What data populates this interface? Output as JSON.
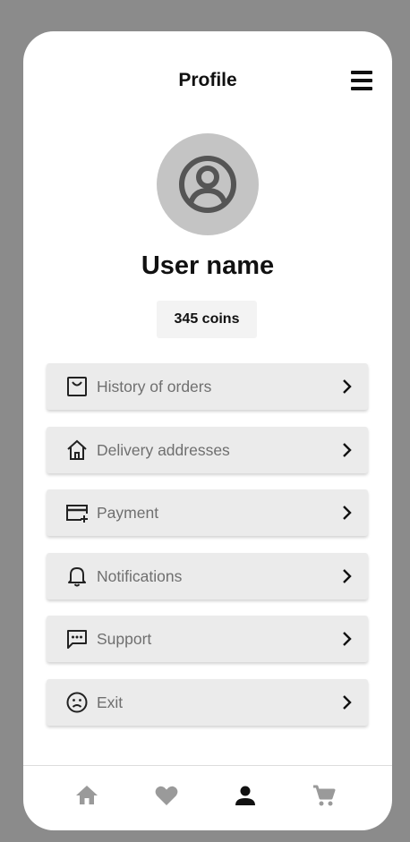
{
  "header": {
    "title": "Profile",
    "menu_icon": "hamburger-menu-icon"
  },
  "profile": {
    "avatar_icon": "account-circle-icon",
    "username": "User name",
    "coins": "345 coins"
  },
  "menu": [
    {
      "label": "History of orders",
      "icon": "shopping-bag-icon"
    },
    {
      "label": "Delivery addresses",
      "icon": "home-outline-icon"
    },
    {
      "label": "Payment",
      "icon": "credit-card-plus-icon"
    },
    {
      "label": "Notifications",
      "icon": "bell-icon"
    },
    {
      "label": "Support",
      "icon": "chat-bubble-icon"
    },
    {
      "label": "Exit",
      "icon": "sad-face-icon"
    }
  ],
  "bottom_nav": [
    {
      "name": "home",
      "icon": "home-icon",
      "active": false
    },
    {
      "name": "favorites",
      "icon": "heart-icon",
      "active": false
    },
    {
      "name": "profile",
      "icon": "person-icon",
      "active": true
    },
    {
      "name": "cart",
      "icon": "shopping-cart-icon",
      "active": false
    }
  ],
  "colors": {
    "background": "#8b8b8b",
    "card": "#ffffff",
    "menu_item": "#ebebeb",
    "text_primary": "#111111",
    "text_secondary": "#6f6f6f",
    "nav_inactive": "#9a9a9a",
    "nav_active": "#111111"
  }
}
